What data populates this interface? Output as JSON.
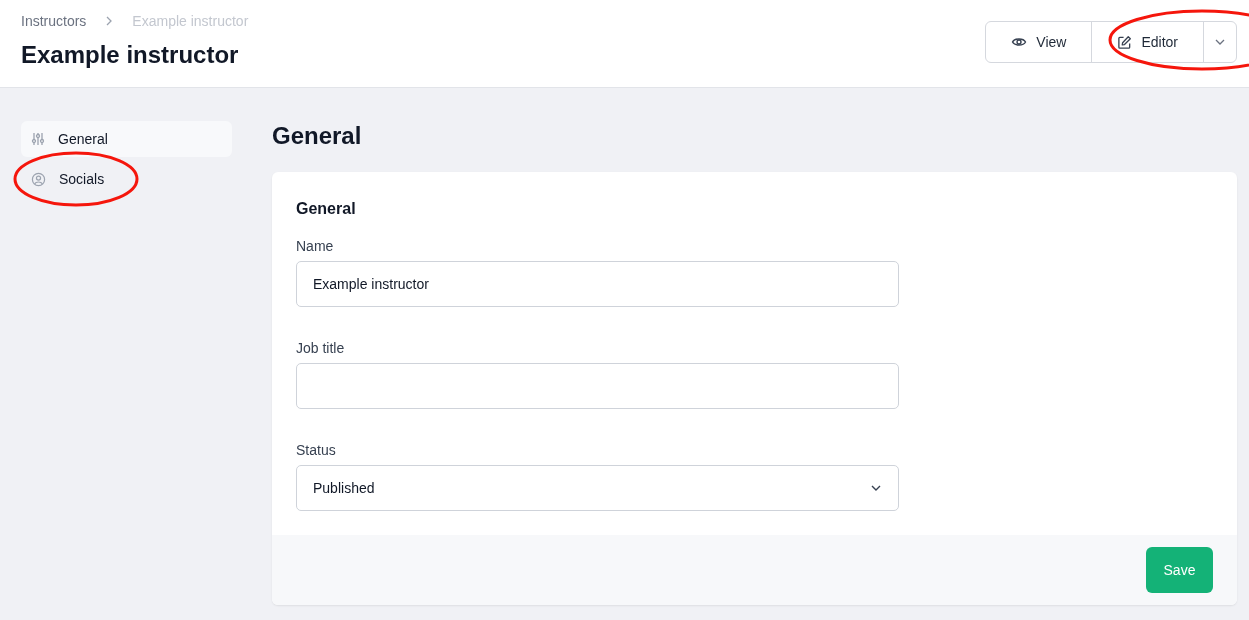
{
  "breadcrumbs": [
    {
      "label": "Instructors",
      "current": false
    },
    {
      "label": "Example instructor",
      "current": true
    }
  ],
  "title": "Example instructor",
  "actions": [
    {
      "kind": "view",
      "label": "View",
      "circled": false
    },
    {
      "kind": "editor",
      "label": "Editor",
      "circled": true
    }
  ],
  "sidebar": {
    "items": [
      {
        "label": "General",
        "kind": "sliders",
        "selected": true,
        "circled": false
      },
      {
        "label": "Socials",
        "kind": "user-circle",
        "selected": false,
        "circled": true
      }
    ]
  },
  "section_title": "General",
  "card": {
    "title": "General",
    "fields": [
      {
        "kind": "text",
        "label": "Name",
        "value": "Example instructor"
      },
      {
        "kind": "text",
        "label": "Job title"
      },
      {
        "kind": "select",
        "label": "Status",
        "value": "Published"
      }
    ],
    "save_button": "Save"
  }
}
